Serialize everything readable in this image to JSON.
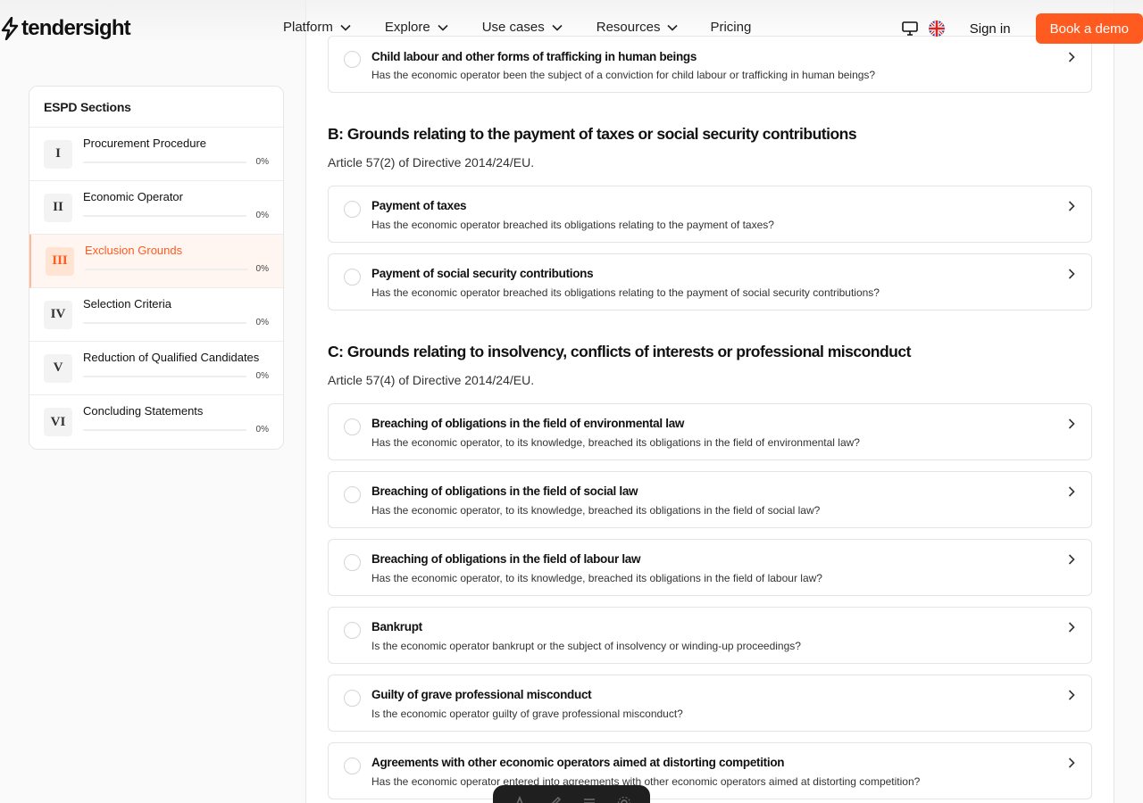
{
  "nav": {
    "logo_text": "tendersight",
    "menu": [
      {
        "label": "Platform",
        "has_dropdown": true
      },
      {
        "label": "Explore",
        "has_dropdown": true
      },
      {
        "label": "Use cases",
        "has_dropdown": true
      },
      {
        "label": "Resources",
        "has_dropdown": true
      },
      {
        "label": "Pricing",
        "has_dropdown": false
      }
    ],
    "signin": "Sign in",
    "demo": "Book a demo",
    "accent": "#ff5a1f"
  },
  "sidebar": {
    "title": "ESPD Sections",
    "sections": [
      {
        "numeral": "I",
        "label": "Procurement Procedure",
        "percent": "0%",
        "progress": 0,
        "active": false
      },
      {
        "numeral": "II",
        "label": "Economic Operator",
        "percent": "0%",
        "progress": 0,
        "active": false
      },
      {
        "numeral": "III",
        "label": "Exclusion Grounds",
        "percent": "0%",
        "progress": 0,
        "active": true
      },
      {
        "numeral": "IV",
        "label": "Selection Criteria",
        "percent": "0%",
        "progress": 0,
        "active": false
      },
      {
        "numeral": "V",
        "label": "Reduction of Qualified Candidates",
        "percent": "0%",
        "progress": 0,
        "active": false
      },
      {
        "numeral": "VI",
        "label": "Concluding Statements",
        "percent": "0%",
        "progress": 0,
        "active": false
      }
    ]
  },
  "main": {
    "top_question": {
      "title": "Child labour and other forms of trafficking in human beings",
      "desc": "Has the economic operator been the subject of a conviction for child labour or trafficking in human beings?"
    },
    "section_b": {
      "heading": "B: Grounds relating to the payment of taxes or social security contributions",
      "sub": "Article 57(2) of Directive 2014/24/EU.",
      "questions": [
        {
          "title": "Payment of taxes",
          "desc": "Has the economic operator breached its obligations relating to the payment of taxes?"
        },
        {
          "title": "Payment of social security contributions",
          "desc": "Has the economic operator breached its obligations relating to the payment of social security contributions?"
        }
      ]
    },
    "section_c": {
      "heading": "C: Grounds relating to insolvency, conflicts of interests or professional misconduct",
      "sub": "Article 57(4) of Directive 2014/24/EU.",
      "questions": [
        {
          "title": "Breaching of obligations in the field of environmental law",
          "desc": "Has the economic operator, to its knowledge, breached its obligations in the field of environmental law?"
        },
        {
          "title": "Breaching of obligations in the field of social law",
          "desc": "Has the economic operator, to its knowledge, breached its obligations in the field of social law?"
        },
        {
          "title": "Breaching of obligations in the field of labour law",
          "desc": "Has the economic operator, to its knowledge, breached its obligations in the field of labour law?"
        },
        {
          "title": "Bankrupt",
          "desc": "Is the economic operator bankrupt or the subject of insolvency or winding-up proceedings?"
        },
        {
          "title": "Guilty of grave professional misconduct",
          "desc": "Is the economic operator guilty of grave professional misconduct?"
        },
        {
          "title": "Agreements with other economic operators aimed at distorting competition",
          "desc": "Has the economic operator entered into agreements with other economic operators aimed at distorting competition?"
        }
      ]
    }
  }
}
